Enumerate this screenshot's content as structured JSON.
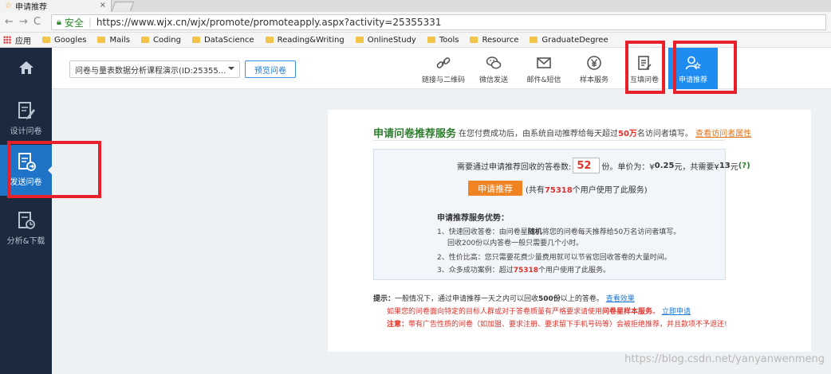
{
  "browser": {
    "tab_title": "申请推荐",
    "tab_close": "×",
    "back": "←",
    "forward": "→",
    "reload": "C",
    "secure_label": "安全",
    "url": "https://www.wjx.cn/wjx/promote/promoteapply.aspx?activity=25355331",
    "bookmarks": [
      "应用",
      "Googles",
      "Mails",
      "Coding",
      "DataScience",
      "Reading&Writing",
      "OnlineStudy",
      "Tools",
      "Resource",
      "GraduateDegree"
    ]
  },
  "sidebar": {
    "items": [
      {
        "label": "设计问卷"
      },
      {
        "label": "发送问卷"
      },
      {
        "label": "分析&下载"
      }
    ]
  },
  "toolbar": {
    "survey_select": "问卷与量表数据分析课程演示(ID:25355...",
    "preview_label": "预览问卷",
    "tools": [
      {
        "label": "链接与二维码"
      },
      {
        "label": "微信发送"
      },
      {
        "label": "邮件&短信"
      },
      {
        "label": "样本服务"
      },
      {
        "label": "互填问卷"
      },
      {
        "label": "申请推荐"
      }
    ]
  },
  "panel": {
    "title": "申请问卷推荐服务",
    "sub_prefix": "在您付费成功后，由系统自动推荐给每天超过",
    "sub_highlight": "50万",
    "sub_suffix": "名访问者填写。",
    "sub_link": "查看访问者属性",
    "qty_prefix": "需要通过申请推荐回收的答卷数:",
    "qty_value": "52",
    "qty_unit": "份。单价为：¥",
    "unit_price": "0.25",
    "total_prefix": "元，共需要¥",
    "total_value": "13",
    "total_suffix": "元",
    "help_mark": "(?)",
    "apply_label": "申请推荐",
    "apply_note_prefix": "(共有",
    "apply_note_count": "75318",
    "apply_note_suffix": "个用户使用了此服务)",
    "adv_title": "申请推荐服务优势：",
    "adv1_prefix": "1、快速回收答卷：由问卷星",
    "adv1_bold": "随机",
    "adv1_suffix": "将您的问卷每天推荐给50万名访问者填写。",
    "adv1b": "回收200份以内答卷一般只需要几个小时。",
    "adv2": "2、性价比高：您只需要花费少量费用就可以节省您回收答卷的大量时间。",
    "adv3_prefix": "3、众多成功案例：超过",
    "adv3_count": "75318",
    "adv3_suffix": "个用户使用了此服务。",
    "tip1_label": "提示：",
    "tip1_text_a": "一般情况下，通过申请推荐一天之内可以回收",
    "tip1_bold": "500份",
    "tip1_text_b": "以上的答卷。",
    "tip1_link": "查看效果",
    "tip2_text_a": "如果您的问卷面向特定的目标人群或对于答卷质量有严格要求请使用",
    "tip2_bold": "问卷星样本服务",
    "tip2_text_b": "。",
    "tip2_link": "立即申请",
    "tip3_label": "注意：",
    "tip3_text": "带有广告性质的问卷（如加盟、要求注册、要求留下手机号码等）会被拒绝推荐，并且款项不予退还!"
  },
  "watermark": "https://blog.csdn.net/yanyanwenmeng",
  "colors": {
    "sidebar_bg": "#1b2a3e",
    "active_blue": "#1e8cf0",
    "orange": "#f08322",
    "red": "#e0322b",
    "green": "#2e7d2e"
  }
}
